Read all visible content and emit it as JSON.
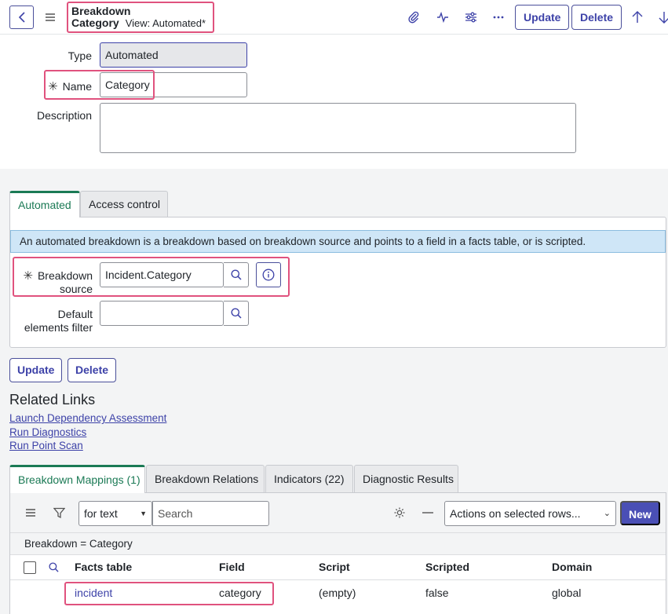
{
  "header": {
    "title_line1": "Breakdown",
    "title_line2": "Category",
    "view": "View: Automated*",
    "update_label": "Update",
    "delete_label": "Delete"
  },
  "form": {
    "type_label": "Type",
    "type_value": "Automated",
    "name_label": "Name",
    "name_value": "Category",
    "description_label": "Description",
    "description_value": ""
  },
  "section_tabs": [
    {
      "label": "Automated",
      "active": true
    },
    {
      "label": "Access control",
      "active": false
    }
  ],
  "automated": {
    "info_text": "An automated breakdown is a breakdown based on breakdown source and points to a field in a facts table, or is scripted.",
    "source_label_1": "Breakdown",
    "source_label_2": "source",
    "source_value": "Incident.Category",
    "filter_label_1": "Default",
    "filter_label_2": "elements filter",
    "filter_value": ""
  },
  "bottom_buttons": {
    "update_label": "Update",
    "delete_label": "Delete"
  },
  "related_links": {
    "title": "Related Links",
    "links": [
      "Launch Dependency Assessment",
      "Run Diagnostics",
      "Run Point Scan"
    ]
  },
  "related_tabs": [
    {
      "label": "Breakdown Mappings (1)",
      "active": true
    },
    {
      "label": "Breakdown Relations",
      "active": false
    },
    {
      "label": "Indicators (22)",
      "active": false
    },
    {
      "label": "Diagnostic Results",
      "active": false
    }
  ],
  "list": {
    "search_field_select": "for text",
    "search_placeholder": "Search",
    "actions_select": "Actions on selected rows...",
    "new_label": "New",
    "filter_text": "Breakdown = Category",
    "columns": [
      "Facts table",
      "Field",
      "Script",
      "Scripted",
      "Domain"
    ],
    "rows": [
      {
        "facts_table": "incident",
        "field": "category",
        "script": "(empty)",
        "scripted": "false",
        "domain": "global"
      }
    ]
  },
  "colors": {
    "accent": "#3d42a8",
    "highlight": "#e0527e",
    "active_tab": "#1b7a55",
    "info_bar": "#cfe6f7"
  }
}
